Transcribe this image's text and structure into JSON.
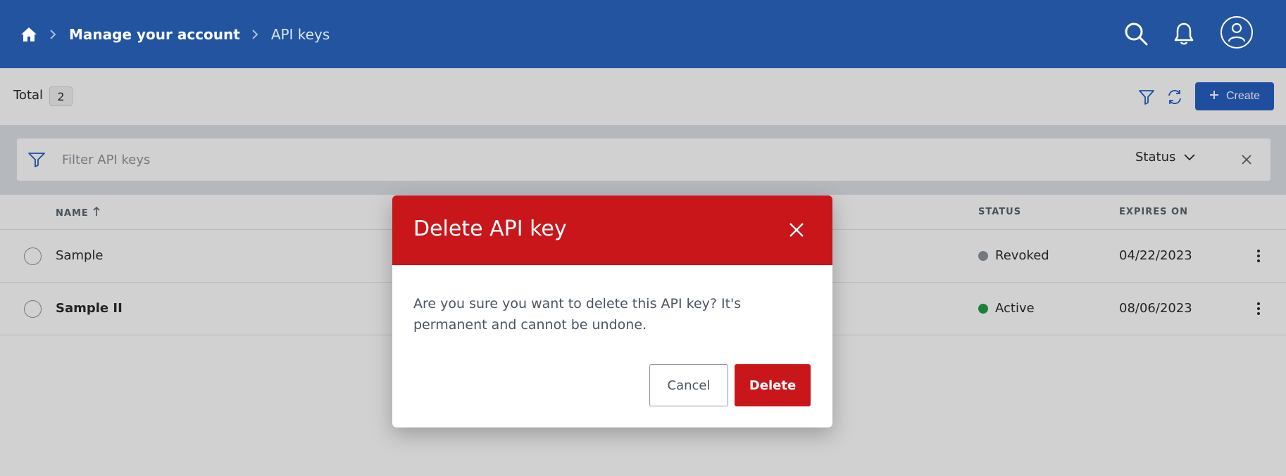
{
  "header": {
    "breadcrumb": {
      "home_icon": "home-icon",
      "separator_icon": "chevron-right-icon",
      "manage_account": "Manage your account",
      "current": "API keys"
    },
    "icons": [
      "search-icon",
      "bell-icon",
      "user-icon"
    ]
  },
  "toolbar": {
    "total_label": "Total",
    "total_count": "2",
    "filter_icon": "filter-icon",
    "refresh_icon": "refresh-icon",
    "create_label": "Create",
    "create_icon": "plus-icon"
  },
  "filter": {
    "placeholder": "Filter API keys",
    "status_label": "Status",
    "status_icon": "chevron-down-icon",
    "clear_icon": "close-icon"
  },
  "table": {
    "columns": {
      "name": "NAME",
      "status": "STATUS",
      "expires": "EXPIRES ON"
    },
    "rows": [
      {
        "name": "Sample",
        "status": "Revoked",
        "expires": "04/22/2023"
      },
      {
        "name": "Sample II",
        "status": "Active",
        "expires": "08/06/2023"
      }
    ]
  },
  "colors": {
    "header_bg": "#2254a0",
    "accent_blue": "#2660c2",
    "danger_red": "#c8161a",
    "status_revoked": "#8e949b",
    "status_active": "#1f9e4b"
  },
  "modal": {
    "title": "Delete API key",
    "body": "Are you sure you want to delete this API key? It's permanent and cannot be undone.",
    "cancel_label": "Cancel",
    "delete_label": "Delete",
    "close_icon": "close-icon"
  }
}
